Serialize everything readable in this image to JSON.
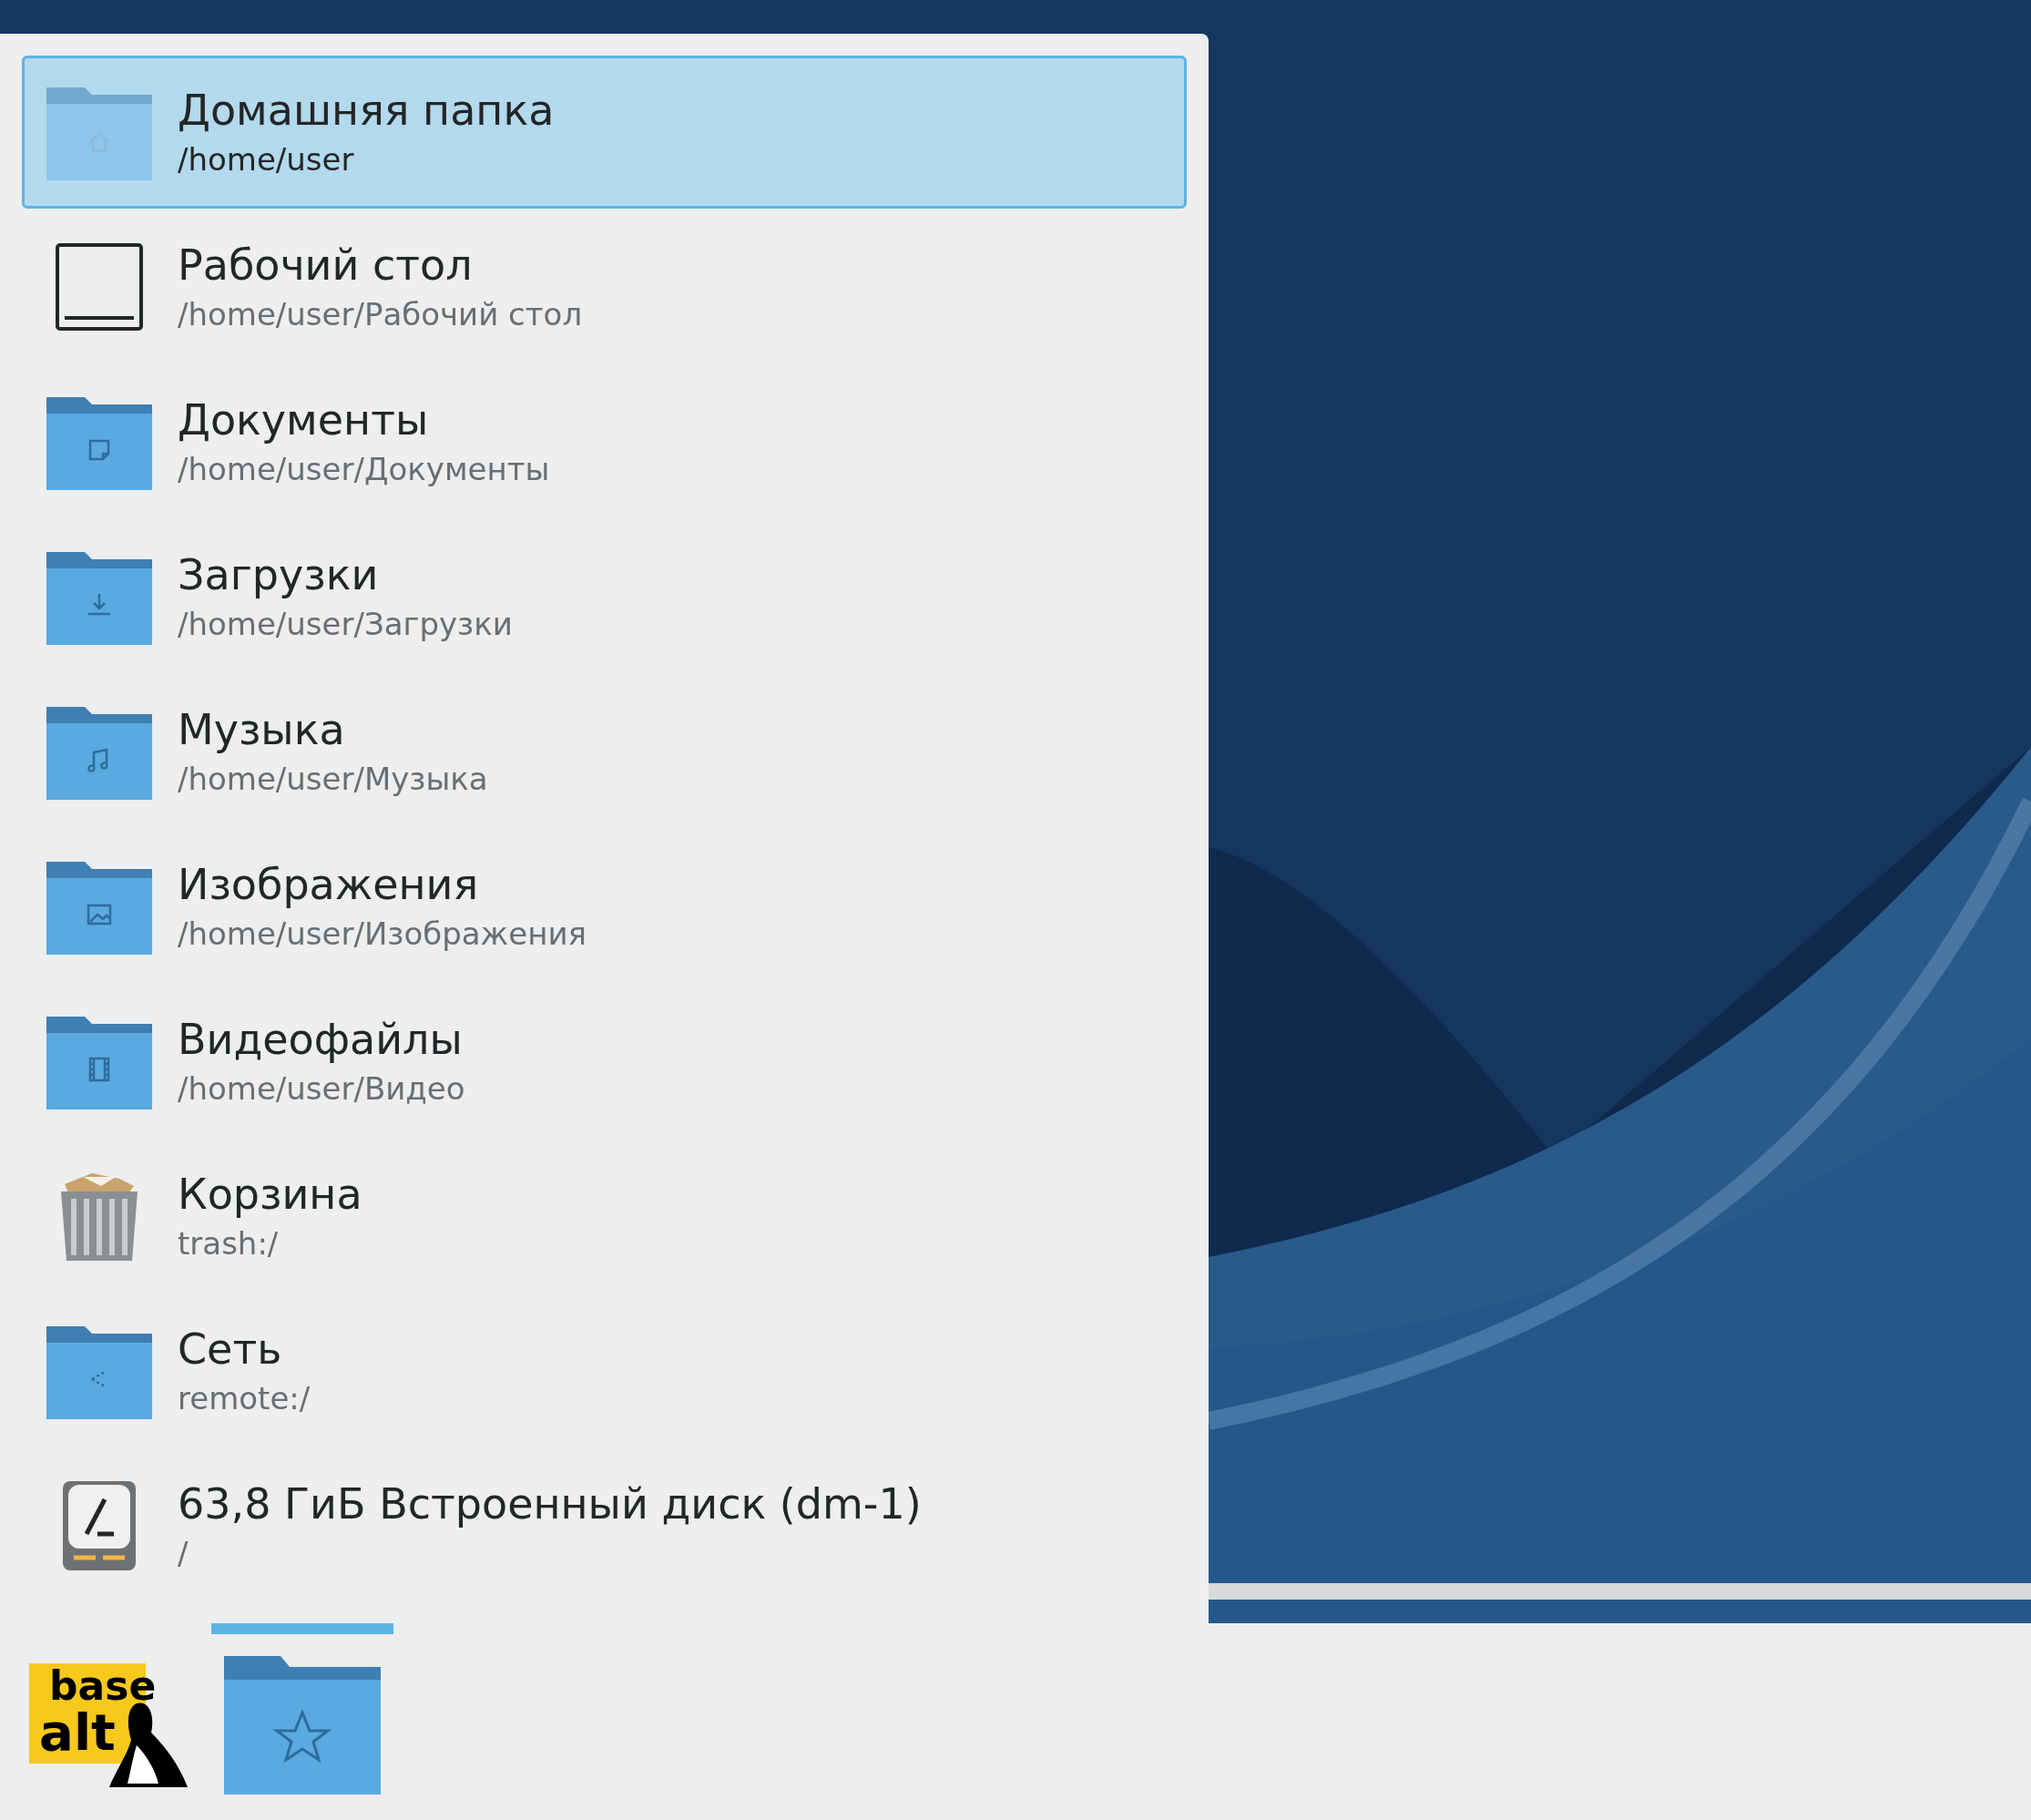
{
  "places": [
    {
      "kind": "home",
      "title": "Домашняя папка",
      "path": "/home/user",
      "selected": true
    },
    {
      "kind": "desktop",
      "title": "Рабочий стол",
      "path": "/home/user/Рабочий стол",
      "selected": false
    },
    {
      "kind": "documents",
      "title": "Документы",
      "path": "/home/user/Документы",
      "selected": false
    },
    {
      "kind": "downloads",
      "title": "Загрузки",
      "path": "/home/user/Загрузки",
      "selected": false
    },
    {
      "kind": "music",
      "title": "Музыка",
      "path": "/home/user/Музыка",
      "selected": false
    },
    {
      "kind": "pictures",
      "title": "Изображения",
      "path": "/home/user/Изображения",
      "selected": false
    },
    {
      "kind": "videos",
      "title": "Видеофайлы",
      "path": "/home/user/Видео",
      "selected": false
    },
    {
      "kind": "trash",
      "title": "Корзина",
      "path": "trash:/",
      "selected": false
    },
    {
      "kind": "network",
      "title": "Сеть",
      "path": "remote:/",
      "selected": false
    },
    {
      "kind": "disk",
      "title": "63,8 ГиБ Встроенный диск (dm-1)",
      "path": "/",
      "selected": false
    }
  ],
  "taskbar": {
    "launcher": {
      "line1": "base",
      "line2": "alt"
    },
    "tasks": [
      {
        "kind": "places",
        "active": true
      }
    ]
  }
}
